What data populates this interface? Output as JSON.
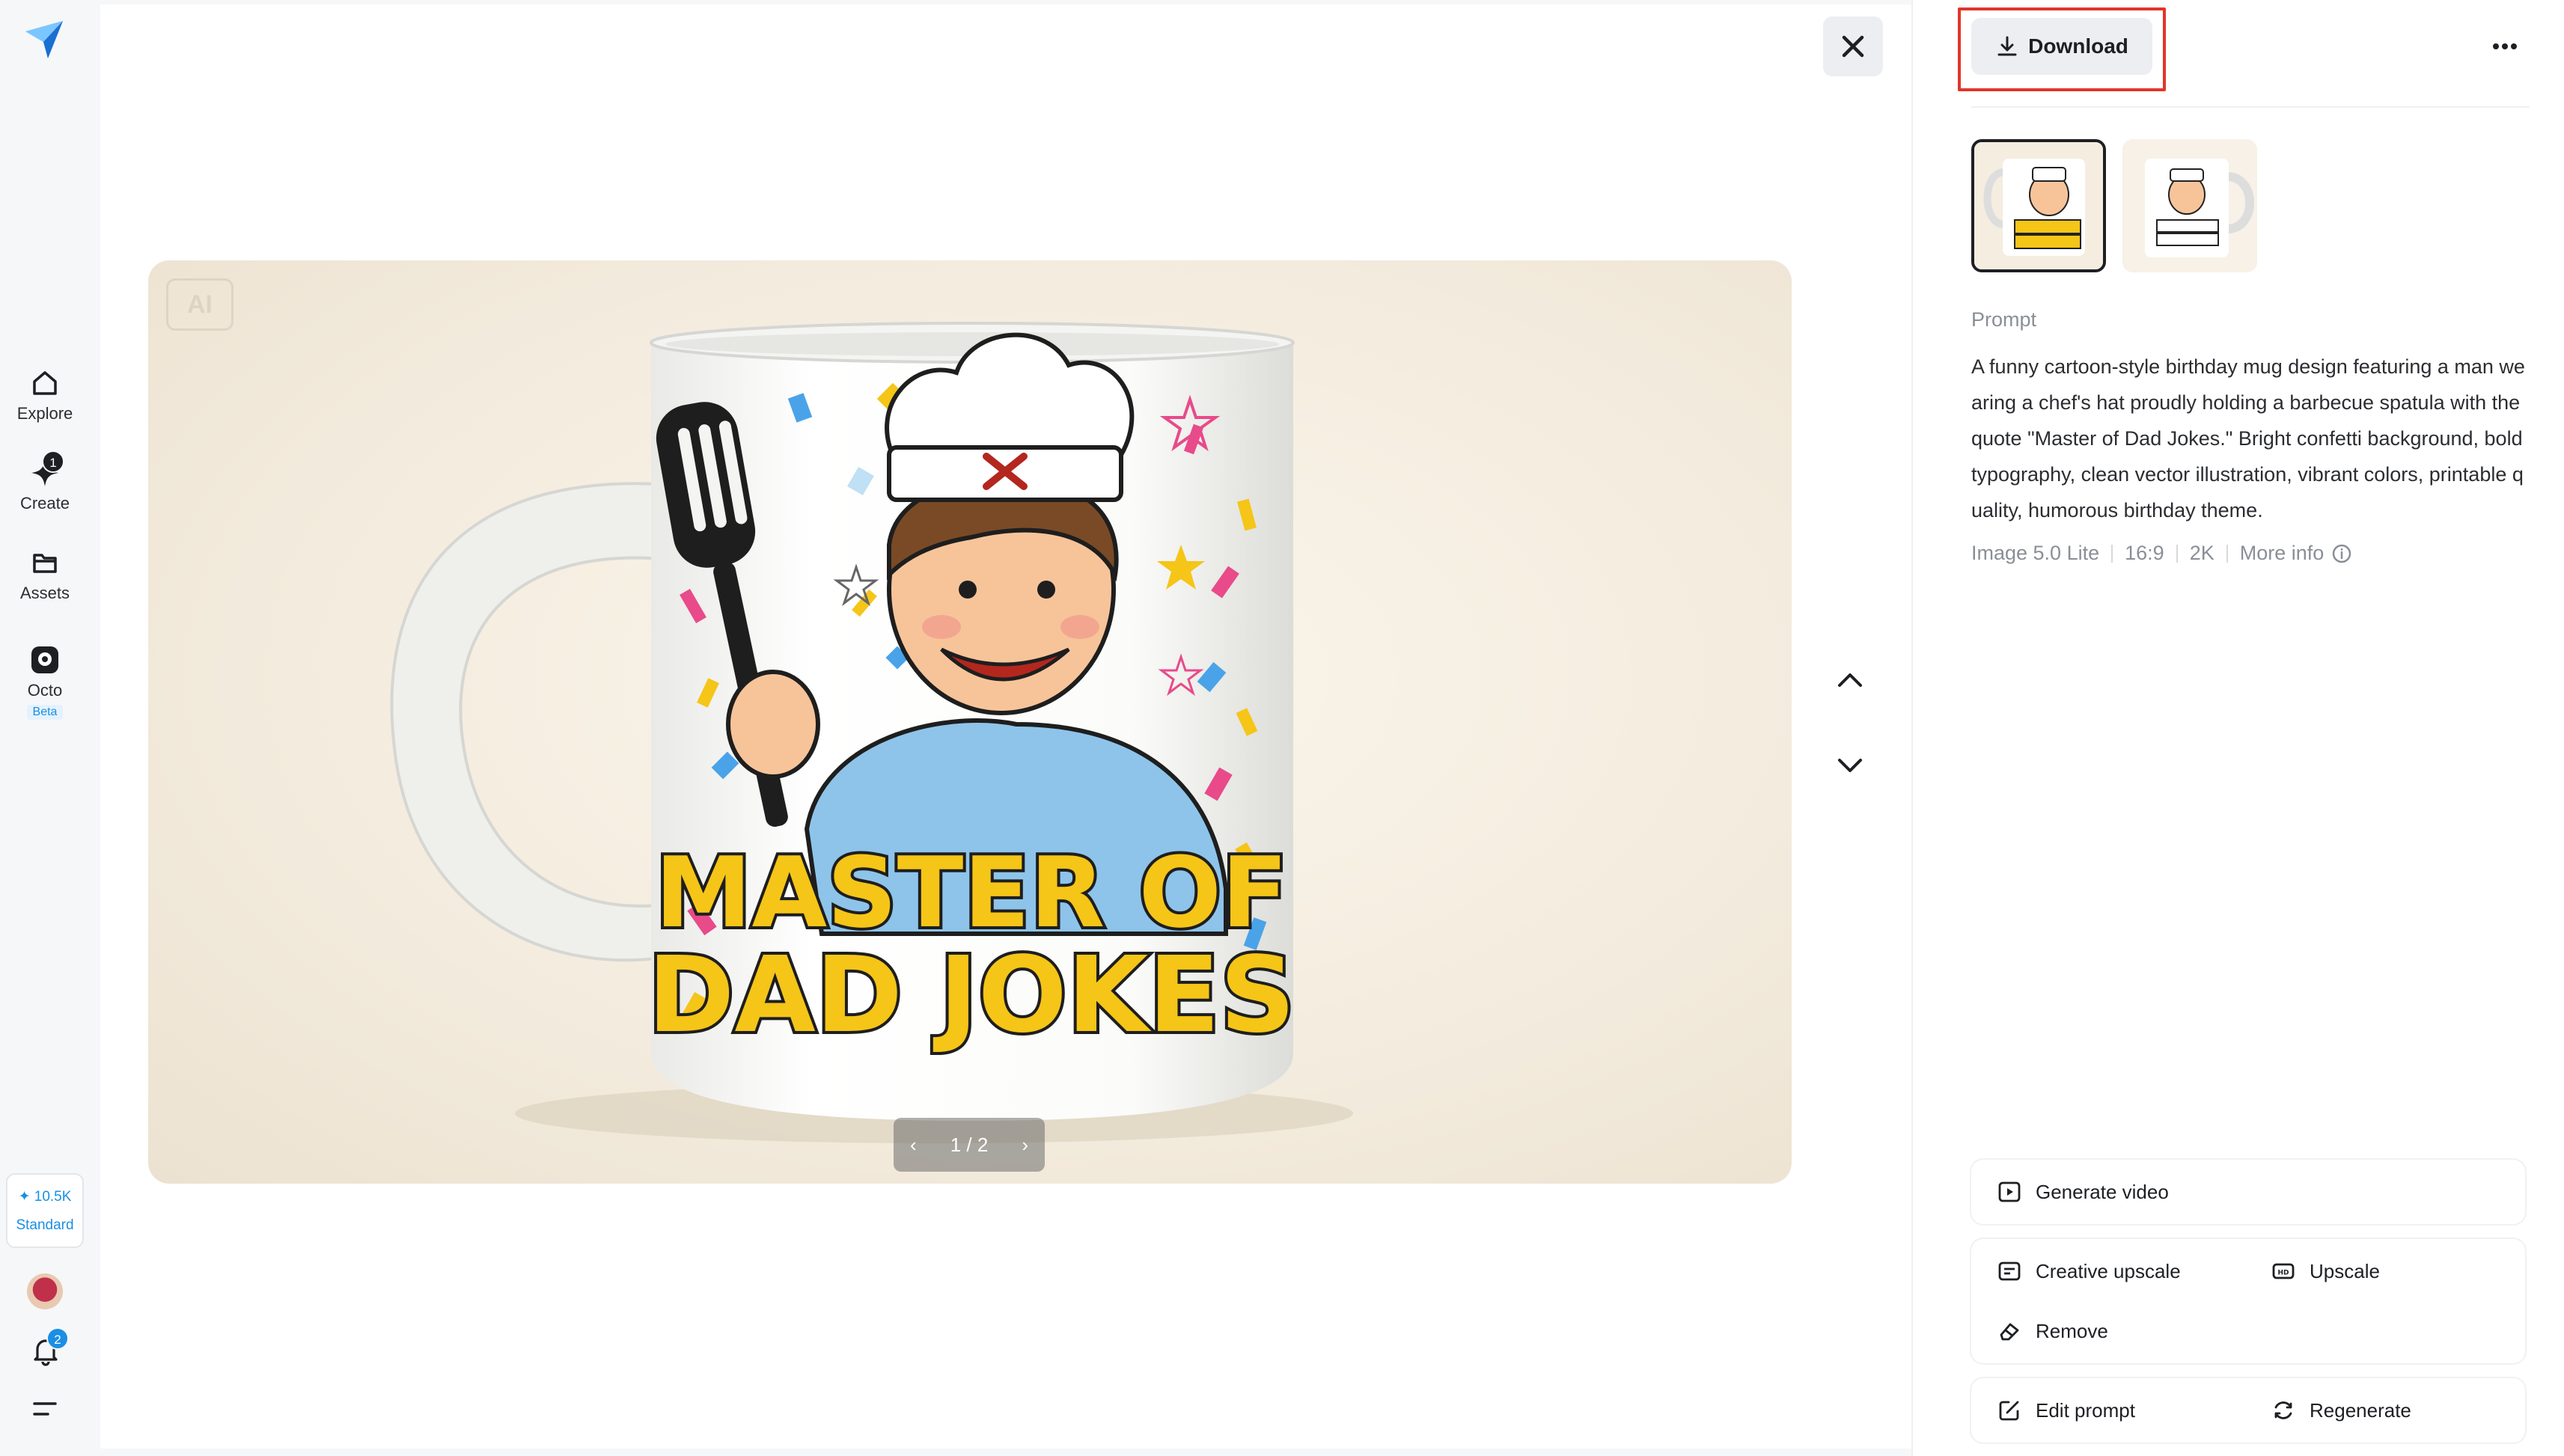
{
  "nav": {
    "items": [
      {
        "label": "Explore",
        "icon": "home-icon"
      },
      {
        "label": "Create",
        "icon": "sparkle-icon",
        "badge": "1"
      },
      {
        "label": "Assets",
        "icon": "folder-icon"
      },
      {
        "label": "Octo",
        "icon": "octo-icon",
        "tag": "Beta"
      }
    ],
    "credits": {
      "amount": "✦ 10.5K",
      "plan": "Standard"
    },
    "notifications_count": "2"
  },
  "viewer": {
    "image_subject": "Mug with cartoon chef holding spatula",
    "mug_text_line1": "MASTER OF",
    "mug_text_line2": "DAD JOKES",
    "ai_chip": "AI",
    "pager": {
      "current": "1",
      "total": "2",
      "text": "1 / 2"
    }
  },
  "panel": {
    "download_label": "Download",
    "prompt_label": "Prompt",
    "prompt_text": "A funny cartoon-style birthday mug design featuring a man wearing a chef's hat proudly holding a barbecue spatula with the quote \"Master of Dad Jokes.\" Bright confetti background, bold typography, clean vector illustration, vibrant colors, printable quality, humorous birthday theme.",
    "meta": {
      "model": "Image 5.0 Lite",
      "ratio": "16:9",
      "resolution": "2K",
      "more_info": "More info"
    },
    "actions": {
      "generate_video": "Generate video",
      "creative_upscale": "Creative upscale",
      "upscale": "Upscale",
      "remove": "Remove",
      "edit_prompt": "Edit prompt",
      "regenerate": "Regenerate"
    }
  },
  "colors": {
    "accent": "#1a8fe3",
    "highlight": "#e2352a",
    "mug_text": "#f5c518"
  }
}
